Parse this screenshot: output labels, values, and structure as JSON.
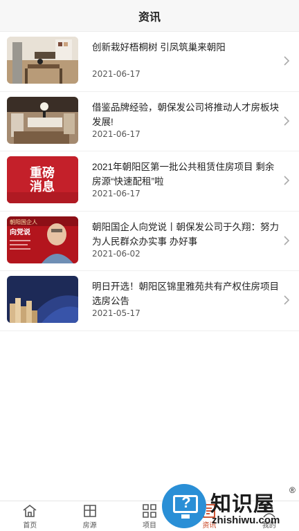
{
  "header": {
    "title": "资讯"
  },
  "news": [
    {
      "title": "创新栽好梧桐树 引凤筑巢来朝阳",
      "date": "2021-06-17",
      "thumb": "kitchen-interior-photo"
    },
    {
      "title": "借鉴品牌经验，朝保发公司将推动人才房板块发展!",
      "date": "2021-06-17",
      "thumb": "dining-room-photo"
    },
    {
      "title": "2021年朝阳区第一批公共租赁住房项目 剩余房源“快速配租”啦",
      "date": "2021-06-17",
      "thumb": "announcement-banner",
      "thumb_text": [
        "重磅",
        "消息"
      ]
    },
    {
      "title": "朝阳国企人向党说丨朝保发公司于久翔：努力为人民群众办实事 办好事",
      "date": "2021-06-02",
      "thumb": "interview-photo",
      "thumb_text": [
        "朝阳国企人",
        "向党说"
      ]
    },
    {
      "title": "明日开选！朝阳区锦里雅苑共有产权住房项目选房公告",
      "date": "2021-05-17",
      "thumb": "buildings-banner"
    }
  ],
  "tabbar": [
    {
      "label": "首页",
      "icon": "home-icon",
      "active": false
    },
    {
      "label": "房源",
      "icon": "housing-icon",
      "active": false
    },
    {
      "label": "项目",
      "icon": "grid-icon",
      "active": false
    },
    {
      "label": "资讯",
      "icon": "news-icon",
      "active": true
    },
    {
      "label": "我的",
      "icon": "user-icon",
      "active": false
    }
  ],
  "watermark": {
    "brand": "知识屋",
    "reg": "®",
    "url": "zhishiwu.com",
    "icon": "question-screen-icon"
  },
  "colors": {
    "accent": "#c8421f",
    "banner_red": "#c4202a",
    "banner_navy": "#1d2a57"
  }
}
